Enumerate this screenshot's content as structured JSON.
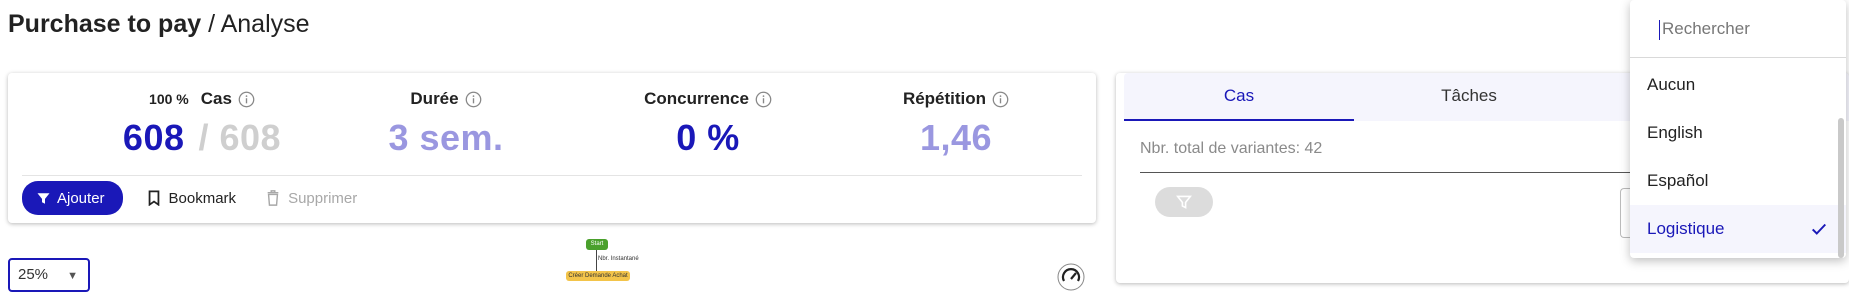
{
  "header": {
    "title_bold": "Purchase to pay",
    "title_rest": " / Analyse"
  },
  "kpis": [
    {
      "pct": "100 %",
      "label": "Cas",
      "value": "608",
      "total": "/ 608"
    },
    {
      "label": "Durée",
      "value": "3 sem."
    },
    {
      "label": "Concurrence",
      "value": "0 %"
    },
    {
      "label": "Répétition",
      "value": "1,46"
    }
  ],
  "actions": {
    "add": "Ajouter",
    "bookmark": "Bookmark",
    "delete": "Supprimer"
  },
  "map": {
    "zoom": "25%",
    "start_node": "Start",
    "edge_label": "Nbr. Instantané",
    "task_node": "Créer Demande Achat"
  },
  "right_panel": {
    "tabs": [
      {
        "label": "Cas"
      },
      {
        "label": "Tâches"
      }
    ],
    "variants_label": "Nbr. total de variantes: 42"
  },
  "dropdown": {
    "search_placeholder": "Rechercher",
    "options": [
      {
        "label": "Aucun"
      },
      {
        "label": "English"
      },
      {
        "label": "Español"
      },
      {
        "label": "Logistique",
        "selected": true
      }
    ]
  },
  "colors": {
    "accent": "#1a18b8",
    "accent_light": "#9a97e0",
    "start_node": "#4aa02c",
    "task_node": "#f3c44a"
  }
}
